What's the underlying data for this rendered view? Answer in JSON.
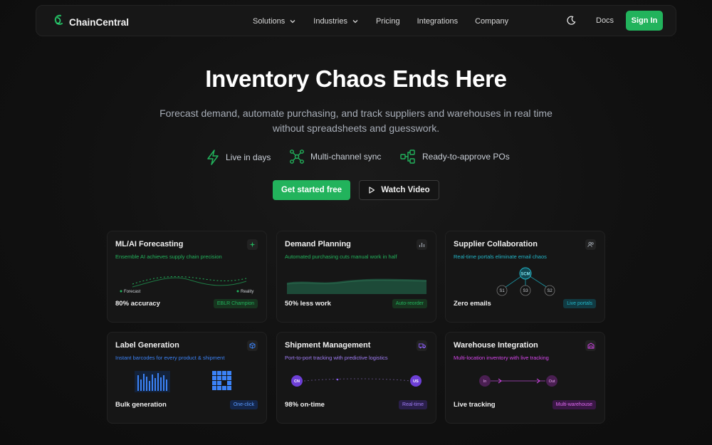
{
  "brand": {
    "name": "ChainCentral",
    "accent": "#22b35c"
  },
  "nav": {
    "menu": [
      {
        "label": "Solutions",
        "dropdown": true
      },
      {
        "label": "Industries",
        "dropdown": true
      },
      {
        "label": "Pricing",
        "dropdown": false
      },
      {
        "label": "Integrations",
        "dropdown": false
      },
      {
        "label": "Company",
        "dropdown": false
      }
    ],
    "docs": "Docs",
    "sign_in": "Sign In"
  },
  "hero": {
    "title": "Inventory Chaos Ends Here",
    "subtitle_line1": "Forecast demand, automate purchasing, and track suppliers and warehouses in real time",
    "subtitle_line2": "without spreadsheets and guesswork.",
    "features": [
      {
        "icon": "lightning-icon",
        "label": "Live in days"
      },
      {
        "icon": "network-icon",
        "label": "Multi-channel sync"
      },
      {
        "icon": "workflow-icon",
        "label": "Ready-to-approve POs"
      }
    ],
    "cta_primary": "Get started free",
    "cta_secondary": "Watch Video"
  },
  "cards": [
    {
      "title": "ML/AI Forecasting",
      "subtitle": "Ensemble AI achieves supply chain precision",
      "subtitle_color": "#22b35c",
      "icon": "sparkle-icon",
      "stat": "80% accuracy",
      "badge": "EBLR Champion",
      "badge_color": "#22b35c",
      "legend": [
        "Forecast",
        "Reality"
      ]
    },
    {
      "title": "Demand Planning",
      "subtitle": "Automated purchasing cuts manual work in half",
      "subtitle_color": "#22b35c",
      "icon": "bar-chart-icon",
      "stat": "50% less work",
      "badge": "Auto-reorder",
      "badge_color": "#22b35c"
    },
    {
      "title": "Supplier Collaboration",
      "subtitle": "Real-time portals eliminate email chaos",
      "subtitle_color": "#22b5c7",
      "icon": "users-icon",
      "stat": "Zero emails",
      "badge": "Live portals",
      "badge_color": "#22b5c7",
      "nodes": {
        "hub": "SCM",
        "s1": "S1",
        "s2": "S2",
        "s3": "S3"
      }
    },
    {
      "title": "Label Generation",
      "subtitle": "Instant barcodes for every product & shipment",
      "subtitle_color": "#3b82f6",
      "icon": "cube-icon",
      "stat": "Bulk generation",
      "badge": "One-click",
      "badge_color": "#3b82f6"
    },
    {
      "title": "Shipment Management",
      "subtitle": "Port-to-port tracking with predictive logistics",
      "subtitle_color": "#8b5cf6",
      "icon": "truck-icon",
      "stat": "98% on-time",
      "badge": "Real-time",
      "badge_color": "#8b5cf6",
      "route": {
        "from": "CN",
        "to": "US"
      }
    },
    {
      "title": "Warehouse Integration",
      "subtitle": "Multi-location inventory with live tracking",
      "subtitle_color": "#d946ef",
      "icon": "warehouse-icon",
      "stat": "Live tracking",
      "badge": "Multi-warehouse",
      "badge_color": "#d946ef",
      "flow": {
        "in": "In",
        "out": "Out"
      }
    }
  ]
}
